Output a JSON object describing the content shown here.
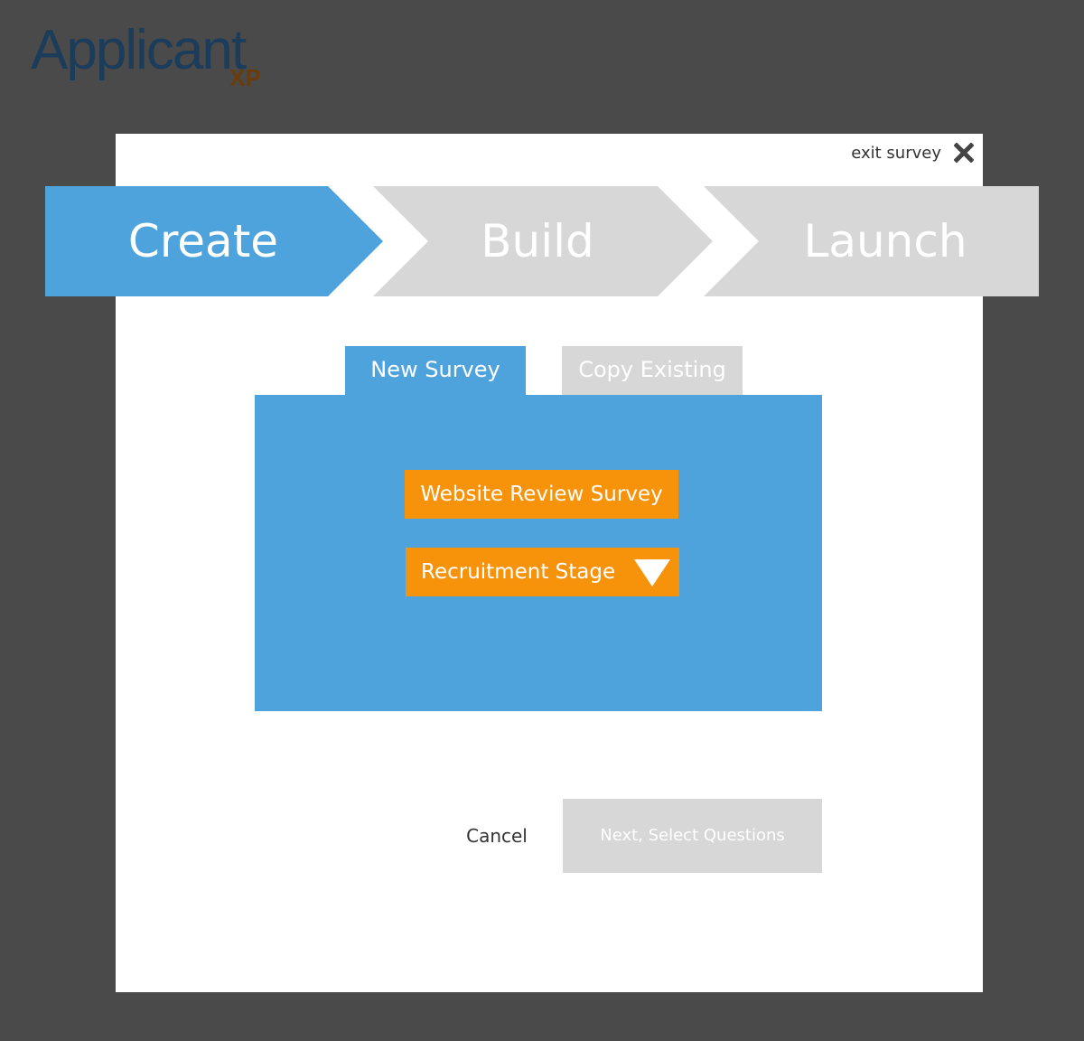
{
  "logo": {
    "main": "Applicant",
    "sub": "XP"
  },
  "modal": {
    "exit_label": "exit survey"
  },
  "steps": [
    {
      "label": "Create",
      "state": "active"
    },
    {
      "label": "Build",
      "state": "inactive"
    },
    {
      "label": "Launch",
      "state": "inactive"
    }
  ],
  "tabs": {
    "new_survey": "New Survey",
    "copy_existing": "Copy Existing",
    "selected": "New Survey"
  },
  "form": {
    "survey_name": "Website Review Survey",
    "recruitment_stage": "Recruitment Stage"
  },
  "footer": {
    "cancel_label": "Cancel",
    "next_label": "Next, Select Questions"
  },
  "colors": {
    "background": "#4a4a4a",
    "accent_blue": "#4fa3dd",
    "inactive_gray": "#d7d7d7",
    "orange": "#f7920b",
    "logo_navy": "#1b3c5a",
    "logo_brown": "#6a3c0a"
  },
  "icons": {
    "exit": "close-icon",
    "dropdown": "triangle-down-icon"
  }
}
